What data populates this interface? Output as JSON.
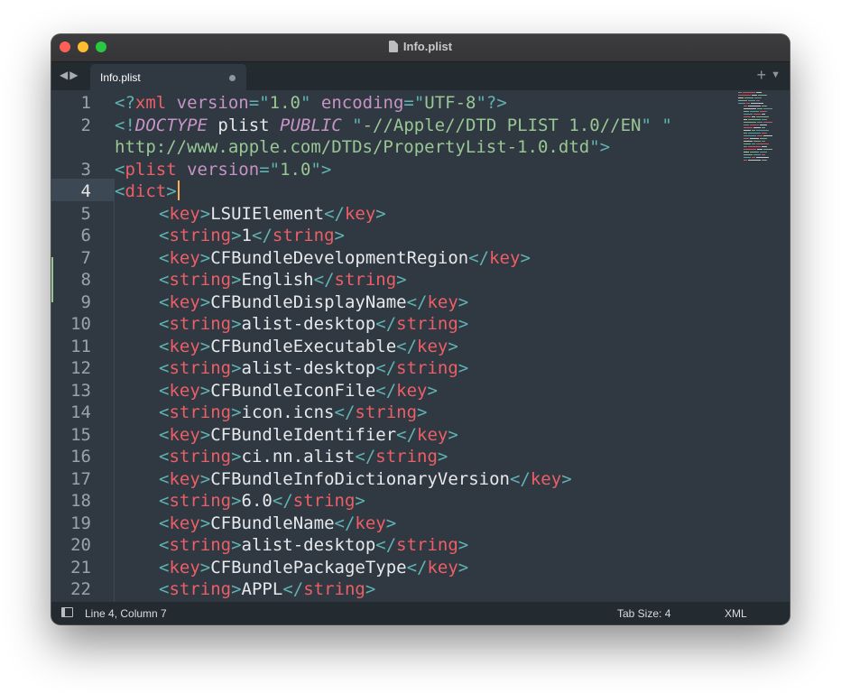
{
  "window": {
    "title": "Info.plist"
  },
  "tabs": [
    {
      "label": "Info.plist",
      "modified": true
    }
  ],
  "tabbar": {
    "nav_icon": "back-forward-arrows",
    "new_tab_icon": "plus-icon",
    "menu_icon": "chevron-down-icon"
  },
  "editor": {
    "current_line": 4,
    "modified_lines": [
      5,
      6
    ],
    "line_numbers": [
      "1",
      "2",
      "",
      "3",
      "4",
      "5",
      "6",
      "7",
      "8",
      "9",
      "10",
      "11",
      "12",
      "13",
      "14",
      "15",
      "16",
      "17",
      "18",
      "19",
      "20",
      "21",
      "22"
    ],
    "lines": [
      [
        [
          "pu",
          "<?"
        ],
        [
          "tg",
          "xml"
        ],
        [
          "tx",
          " "
        ],
        [
          "at",
          "version"
        ],
        [
          "pu",
          "=\""
        ],
        [
          "st",
          "1.0"
        ],
        [
          "pu",
          "\""
        ],
        [
          "tx",
          " "
        ],
        [
          "at",
          "encoding"
        ],
        [
          "pu",
          "=\""
        ],
        [
          "st",
          "UTF-8"
        ],
        [
          "pu",
          "\"?>"
        ]
      ],
      [
        [
          "pu",
          "<!"
        ],
        [
          "kw",
          "DOCTYPE"
        ],
        [
          "tx",
          " plist "
        ],
        [
          "kw",
          "PUBLIC"
        ],
        [
          "tx",
          " "
        ],
        [
          "pu",
          "\""
        ],
        [
          "st",
          "-//Apple//DTD PLIST 1.0//EN"
        ],
        [
          "pu",
          "\""
        ],
        [
          "tx",
          " "
        ],
        [
          "pu",
          "\""
        ]
      ],
      [
        [
          "st",
          "http://www.apple.com/DTDs/PropertyList-1.0.dtd"
        ],
        [
          "pu",
          "\">"
        ]
      ],
      [
        [
          "pu",
          "<"
        ],
        [
          "tg",
          "plist"
        ],
        [
          "tx",
          " "
        ],
        [
          "at",
          "version"
        ],
        [
          "pu",
          "=\""
        ],
        [
          "st",
          "1.0"
        ],
        [
          "pu",
          "\">"
        ]
      ],
      [
        [
          "pu",
          "<"
        ],
        [
          "tg",
          "dict"
        ],
        [
          "pu",
          ">"
        ]
      ],
      [
        [
          "pu",
          "<"
        ],
        [
          "tg",
          "key"
        ],
        [
          "pu",
          ">"
        ],
        [
          "tx",
          "LSUIElement"
        ],
        [
          "pu",
          "</"
        ],
        [
          "tg",
          "key"
        ],
        [
          "pu",
          ">"
        ]
      ],
      [
        [
          "pu",
          "<"
        ],
        [
          "tg",
          "string"
        ],
        [
          "pu",
          ">"
        ],
        [
          "tx",
          "1"
        ],
        [
          "pu",
          "</"
        ],
        [
          "tg",
          "string"
        ],
        [
          "pu",
          ">"
        ]
      ],
      [
        [
          "pu",
          "<"
        ],
        [
          "tg",
          "key"
        ],
        [
          "pu",
          ">"
        ],
        [
          "tx",
          "CFBundleDevelopmentRegion"
        ],
        [
          "pu",
          "</"
        ],
        [
          "tg",
          "key"
        ],
        [
          "pu",
          ">"
        ]
      ],
      [
        [
          "pu",
          "<"
        ],
        [
          "tg",
          "string"
        ],
        [
          "pu",
          ">"
        ],
        [
          "tx",
          "English"
        ],
        [
          "pu",
          "</"
        ],
        [
          "tg",
          "string"
        ],
        [
          "pu",
          ">"
        ]
      ],
      [
        [
          "pu",
          "<"
        ],
        [
          "tg",
          "key"
        ],
        [
          "pu",
          ">"
        ],
        [
          "tx",
          "CFBundleDisplayName"
        ],
        [
          "pu",
          "</"
        ],
        [
          "tg",
          "key"
        ],
        [
          "pu",
          ">"
        ]
      ],
      [
        [
          "pu",
          "<"
        ],
        [
          "tg",
          "string"
        ],
        [
          "pu",
          ">"
        ],
        [
          "tx",
          "alist-desktop"
        ],
        [
          "pu",
          "</"
        ],
        [
          "tg",
          "string"
        ],
        [
          "pu",
          ">"
        ]
      ],
      [
        [
          "pu",
          "<"
        ],
        [
          "tg",
          "key"
        ],
        [
          "pu",
          ">"
        ],
        [
          "tx",
          "CFBundleExecutable"
        ],
        [
          "pu",
          "</"
        ],
        [
          "tg",
          "key"
        ],
        [
          "pu",
          ">"
        ]
      ],
      [
        [
          "pu",
          "<"
        ],
        [
          "tg",
          "string"
        ],
        [
          "pu",
          ">"
        ],
        [
          "tx",
          "alist-desktop"
        ],
        [
          "pu",
          "</"
        ],
        [
          "tg",
          "string"
        ],
        [
          "pu",
          ">"
        ]
      ],
      [
        [
          "pu",
          "<"
        ],
        [
          "tg",
          "key"
        ],
        [
          "pu",
          ">"
        ],
        [
          "tx",
          "CFBundleIconFile"
        ],
        [
          "pu",
          "</"
        ],
        [
          "tg",
          "key"
        ],
        [
          "pu",
          ">"
        ]
      ],
      [
        [
          "pu",
          "<"
        ],
        [
          "tg",
          "string"
        ],
        [
          "pu",
          ">"
        ],
        [
          "tx",
          "icon.icns"
        ],
        [
          "pu",
          "</"
        ],
        [
          "tg",
          "string"
        ],
        [
          "pu",
          ">"
        ]
      ],
      [
        [
          "pu",
          "<"
        ],
        [
          "tg",
          "key"
        ],
        [
          "pu",
          ">"
        ],
        [
          "tx",
          "CFBundleIdentifier"
        ],
        [
          "pu",
          "</"
        ],
        [
          "tg",
          "key"
        ],
        [
          "pu",
          ">"
        ]
      ],
      [
        [
          "pu",
          "<"
        ],
        [
          "tg",
          "string"
        ],
        [
          "pu",
          ">"
        ],
        [
          "tx",
          "ci.nn.alist"
        ],
        [
          "pu",
          "</"
        ],
        [
          "tg",
          "string"
        ],
        [
          "pu",
          ">"
        ]
      ],
      [
        [
          "pu",
          "<"
        ],
        [
          "tg",
          "key"
        ],
        [
          "pu",
          ">"
        ],
        [
          "tx",
          "CFBundleInfoDictionaryVersion"
        ],
        [
          "pu",
          "</"
        ],
        [
          "tg",
          "key"
        ],
        [
          "pu",
          ">"
        ]
      ],
      [
        [
          "pu",
          "<"
        ],
        [
          "tg",
          "string"
        ],
        [
          "pu",
          ">"
        ],
        [
          "tx",
          "6.0"
        ],
        [
          "pu",
          "</"
        ],
        [
          "tg",
          "string"
        ],
        [
          "pu",
          ">"
        ]
      ],
      [
        [
          "pu",
          "<"
        ],
        [
          "tg",
          "key"
        ],
        [
          "pu",
          ">"
        ],
        [
          "tx",
          "CFBundleName"
        ],
        [
          "pu",
          "</"
        ],
        [
          "tg",
          "key"
        ],
        [
          "pu",
          ">"
        ]
      ],
      [
        [
          "pu",
          "<"
        ],
        [
          "tg",
          "string"
        ],
        [
          "pu",
          ">"
        ],
        [
          "tx",
          "alist-desktop"
        ],
        [
          "pu",
          "</"
        ],
        [
          "tg",
          "string"
        ],
        [
          "pu",
          ">"
        ]
      ],
      [
        [
          "pu",
          "<"
        ],
        [
          "tg",
          "key"
        ],
        [
          "pu",
          ">"
        ],
        [
          "tx",
          "CFBundlePackageType"
        ],
        [
          "pu",
          "</"
        ],
        [
          "tg",
          "key"
        ],
        [
          "pu",
          ">"
        ]
      ],
      [
        [
          "pu",
          "<"
        ],
        [
          "tg",
          "string"
        ],
        [
          "pu",
          ">"
        ],
        [
          "tx",
          "APPL"
        ],
        [
          "pu",
          "</"
        ],
        [
          "tg",
          "string"
        ],
        [
          "pu",
          ">"
        ]
      ]
    ],
    "indented": [
      false,
      false,
      false,
      false,
      false,
      true,
      true,
      true,
      true,
      true,
      true,
      true,
      true,
      true,
      true,
      true,
      true,
      true,
      true,
      true,
      true,
      true,
      true
    ]
  },
  "statusbar": {
    "position": "Line 4, Column 7",
    "tab_size": "Tab Size: 4",
    "syntax": "XML",
    "panel_icon": "sidebar-toggle-icon"
  },
  "colors": {
    "background": "#303841",
    "punctuation": "#5fb3b3",
    "tag": "#ec5f67",
    "attribute": "#c594c5",
    "string": "#99c794",
    "text": "#e6e9ec",
    "caret": "#f9ae58"
  }
}
